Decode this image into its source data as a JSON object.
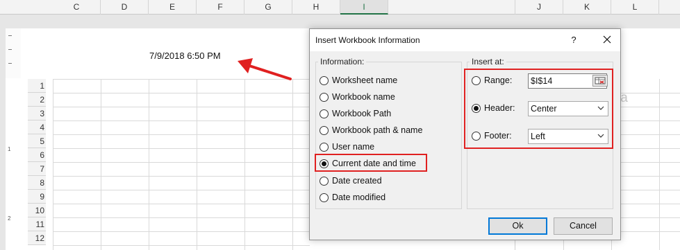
{
  "sheet": {
    "columns": [
      "C",
      "D",
      "E",
      "F",
      "G",
      "H",
      "I",
      "J",
      "K",
      "L"
    ],
    "rows": [
      "1",
      "2",
      "3",
      "4",
      "5",
      "6",
      "7",
      "8",
      "9",
      "10",
      "11",
      "12"
    ],
    "ruler_labels": [
      "1",
      "1",
      "2"
    ],
    "header_text": "7/9/2018 6:50 PM",
    "watermark_text": "ta"
  },
  "dialog": {
    "title": "Insert Workbook Information",
    "help_label": "?",
    "information": {
      "title": "Information:",
      "options": [
        {
          "label": "Worksheet name",
          "checked": false
        },
        {
          "label": "Workbook name",
          "checked": false
        },
        {
          "label": "Workbook Path",
          "checked": false
        },
        {
          "label": "Workbook path & name",
          "checked": false
        },
        {
          "label": "User name",
          "checked": false
        },
        {
          "label": "Current date and time",
          "checked": true
        },
        {
          "label": "Date created",
          "checked": false
        },
        {
          "label": "Date modified",
          "checked": false
        }
      ]
    },
    "insert_at": {
      "title": "Insert at:",
      "range": {
        "label": "Range:",
        "value": "$I$14",
        "checked": false
      },
      "header": {
        "label": "Header:",
        "value": "Center",
        "checked": true
      },
      "footer": {
        "label": "Footer:",
        "value": "Left",
        "checked": false
      }
    },
    "ok_label": "Ok",
    "cancel_label": "Cancel"
  },
  "colors": {
    "highlight": "#e02020",
    "accent": "#0078d7",
    "excel_green": "#217346"
  },
  "icons": {
    "range_select": "range-select-icon",
    "close": "close-icon",
    "dropdown": "chevron-down-icon",
    "annotation": "annotation-arrow"
  }
}
